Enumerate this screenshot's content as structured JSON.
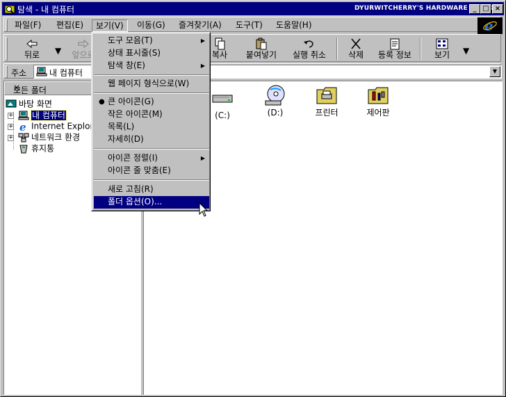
{
  "window": {
    "title": "탐색 - 내 컴퓨터",
    "brand": "DYURWITCHERRY'S HARDWARE SECTOR",
    "controls": {
      "minimize": "_",
      "maximize": "□",
      "close": "×"
    }
  },
  "menubar": {
    "items": [
      {
        "label": "파일(F)"
      },
      {
        "label": "편집(E)"
      },
      {
        "label": "보기(V)"
      },
      {
        "label": "이동(G)"
      },
      {
        "label": "즐겨찾기(A)"
      },
      {
        "label": "도구(T)"
      },
      {
        "label": "도움말(H)"
      }
    ]
  },
  "toolbar": {
    "back": "뒤로",
    "forward": "앞으로",
    "copy": "복사",
    "paste": "붙여넣기",
    "undo": "실행 취소",
    "delete": "삭제",
    "properties": "등록 정보",
    "views": "보기"
  },
  "address": {
    "label": "주소",
    "value": "내 컴퓨터"
  },
  "folders": {
    "header": "모든 폴더",
    "close": "×",
    "items": [
      {
        "label": "바탕 화면"
      },
      {
        "label": "내 컴퓨터"
      },
      {
        "label": "Internet Explorer"
      },
      {
        "label": "네트워크 환경"
      },
      {
        "label": "휴지통"
      }
    ]
  },
  "content": {
    "items": [
      {
        "label": "(C:)",
        "icon": "hard-drive-icon"
      },
      {
        "label": "(D:)",
        "icon": "cd-drive-icon"
      },
      {
        "label": "프린터",
        "icon": "printers-folder-icon"
      },
      {
        "label": "제어판",
        "icon": "control-panel-icon"
      }
    ]
  },
  "view_menu": {
    "items": [
      {
        "label": "도구 모음(T)",
        "submenu": true
      },
      {
        "label": "상태 표시줄(S)"
      },
      {
        "label": "탐색 창(E)",
        "submenu": true
      },
      {
        "label": "웹 페이지 형식으로(W)"
      },
      {
        "label": "큰 아이콘(G)",
        "checked": true
      },
      {
        "label": "작은 아이콘(M)"
      },
      {
        "label": "목록(L)"
      },
      {
        "label": "자세히(D)"
      },
      {
        "label": "아이콘 정렬(I)",
        "submenu": true
      },
      {
        "label": "아이콘 줄 맞춤(E)"
      },
      {
        "label": "새로 고침(R)"
      },
      {
        "label": "폴더 옵션(O)...",
        "highlighted": true
      }
    ]
  },
  "colors": {
    "titlebar": "#000080",
    "face": "#c0c0c0",
    "highlight": "#000080"
  }
}
